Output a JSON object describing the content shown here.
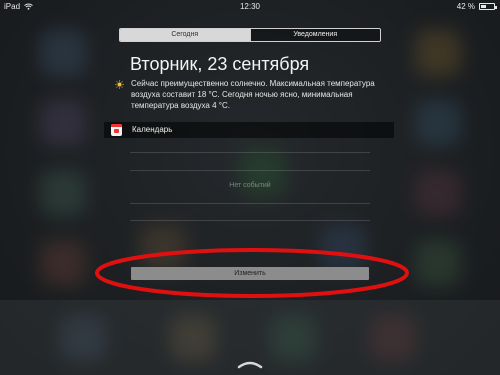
{
  "status_bar": {
    "device": "iPad",
    "time": "12:30",
    "battery_percent": "42 %",
    "battery_level": 0.42
  },
  "tabs": [
    {
      "label": "Сегодня",
      "active": true
    },
    {
      "label": "Уведомления",
      "active": false
    }
  ],
  "today": {
    "date_title": "Вторник, 23 сентября",
    "weather_text": "Сейчас преимущественно солнечно. Максимальная температура воздуха составит 18 °C. Сегодня ночью ясно, минимальная температура воздуха 4 °C.",
    "weather_icon": "sun-icon"
  },
  "calendar": {
    "label": "Календарь",
    "icon": "calendar-icon",
    "empty_text": "Нет событий"
  },
  "edit_button": {
    "label": "Изменить"
  },
  "colors": {
    "highlight": "#e01010",
    "sun": "#f2c230",
    "tab_active_bg": "#d8d8d8"
  }
}
